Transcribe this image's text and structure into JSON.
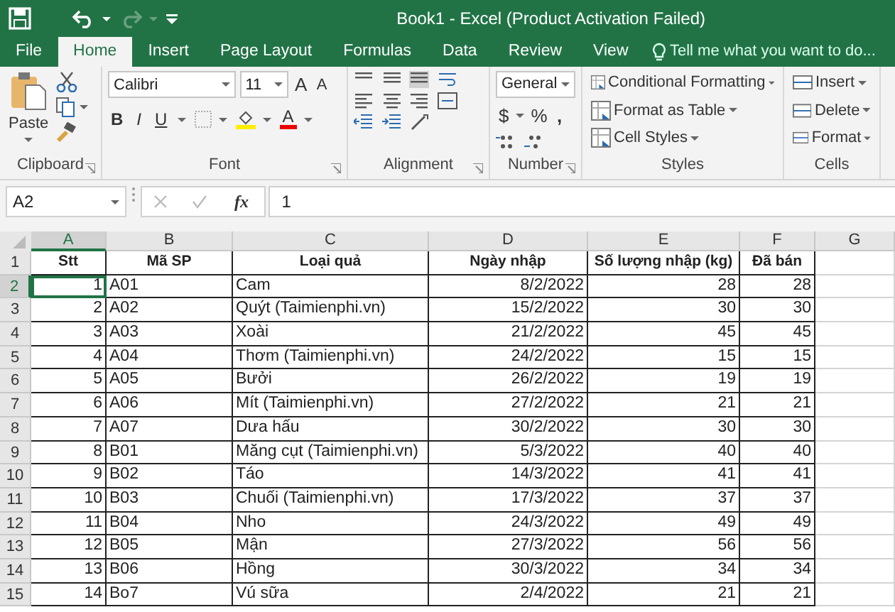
{
  "window": {
    "title": "Book1 - Excel (Product Activation Failed)"
  },
  "tabs": [
    {
      "label": "File",
      "selected": false
    },
    {
      "label": "Home",
      "selected": true
    },
    {
      "label": "Insert",
      "selected": false
    },
    {
      "label": "Page Layout",
      "selected": false
    },
    {
      "label": "Formulas",
      "selected": false
    },
    {
      "label": "Data",
      "selected": false
    },
    {
      "label": "Review",
      "selected": false
    },
    {
      "label": "View",
      "selected": false
    }
  ],
  "tell_me": {
    "placeholder": "Tell me what you want to do..."
  },
  "ribbon": {
    "clipboard": {
      "label": "Clipboard",
      "paste": "Paste"
    },
    "font": {
      "label": "Font",
      "font_name": "Calibri",
      "font_size": "11",
      "grow": "A",
      "shrink": "A",
      "bold": "B",
      "italic": "I",
      "underline": "U",
      "font_color": "A"
    },
    "alignment": {
      "label": "Alignment"
    },
    "number": {
      "label": "Number",
      "format": "General",
      "currency": "$",
      "percent": "%",
      "comma": ","
    },
    "styles": {
      "label": "Styles",
      "buttons": [
        "Conditional Formatting",
        "Format as Table",
        "Cell Styles"
      ]
    },
    "cells": {
      "label": "Cells",
      "buttons": [
        "Insert",
        "Delete",
        "Format"
      ]
    }
  },
  "formula_bar": {
    "name_box": "A2",
    "function_label": "fx",
    "value": "1"
  },
  "sheet": {
    "columns": [
      {
        "label": "A",
        "selected": true,
        "kind": "number"
      },
      {
        "label": "B",
        "selected": false,
        "kind": "text"
      },
      {
        "label": "C",
        "selected": false,
        "kind": "text"
      },
      {
        "label": "D",
        "selected": false,
        "kind": "number"
      },
      {
        "label": "E",
        "selected": false,
        "kind": "number"
      },
      {
        "label": "F",
        "selected": false,
        "kind": "number"
      },
      {
        "label": "G",
        "selected": false,
        "kind": "text"
      }
    ],
    "rows": [
      {
        "header": "1",
        "selected": false,
        "kind": "heading",
        "cells": [
          "Stt",
          "Mã SP",
          "Loại quả",
          "Ngày nhập",
          "Số lượng nhập (kg)",
          "Đã bán",
          ""
        ]
      },
      {
        "header": "2",
        "selected": true,
        "kind": "data",
        "cells": [
          "1",
          "A01",
          "Cam",
          "8/2/2022",
          "28",
          "28",
          ""
        ]
      },
      {
        "header": "3",
        "selected": false,
        "kind": "data",
        "cells": [
          "2",
          "A02",
          "Quýt (Taimienphi.vn)",
          "15/2/2022",
          "30",
          "30",
          ""
        ]
      },
      {
        "header": "4",
        "selected": false,
        "kind": "data",
        "cells": [
          "3",
          "A03",
          "Xoài",
          "21/2/2022",
          "45",
          "45",
          ""
        ]
      },
      {
        "header": "5",
        "selected": false,
        "kind": "data",
        "cells": [
          "4",
          "A04",
          "Thơm  (Taimienphi.vn)",
          "24/2/2022",
          "15",
          "15",
          ""
        ]
      },
      {
        "header": "6",
        "selected": false,
        "kind": "data",
        "cells": [
          "5",
          "A05",
          "Bưởi",
          "26/2/2022",
          "19",
          "19",
          ""
        ]
      },
      {
        "header": "7",
        "selected": false,
        "kind": "data",
        "cells": [
          "6",
          "A06",
          "Mít  (Taimienphi.vn)",
          "27/2/2022",
          "21",
          "21",
          ""
        ]
      },
      {
        "header": "8",
        "selected": false,
        "kind": "data",
        "cells": [
          "7",
          "A07",
          "Dưa hấu",
          "30/2/2022",
          "30",
          "30",
          ""
        ]
      },
      {
        "header": "9",
        "selected": false,
        "kind": "data",
        "cells": [
          "8",
          "B01",
          "Măng cụt  (Taimienphi.vn)",
          "5/3/2022",
          "40",
          "40",
          ""
        ]
      },
      {
        "header": "10",
        "selected": false,
        "kind": "data",
        "cells": [
          "9",
          "B02",
          "Táo",
          "14/3/2022",
          "41",
          "41",
          ""
        ]
      },
      {
        "header": "11",
        "selected": false,
        "kind": "data",
        "cells": [
          "10",
          "B03",
          "Chuối  (Taimienphi.vn)",
          "17/3/2022",
          "37",
          "37",
          ""
        ]
      },
      {
        "header": "12",
        "selected": false,
        "kind": "data",
        "cells": [
          "11",
          "B04",
          "Nho",
          "24/3/2022",
          "49",
          "49",
          ""
        ]
      },
      {
        "header": "13",
        "selected": false,
        "kind": "data",
        "cells": [
          "12",
          "B05",
          "Mận",
          "27/3/2022",
          "56",
          "56",
          ""
        ]
      },
      {
        "header": "14",
        "selected": false,
        "kind": "data",
        "cells": [
          "13",
          "B06",
          "Hồng",
          "30/3/2022",
          "34",
          "34",
          ""
        ]
      },
      {
        "header": "15",
        "selected": false,
        "kind": "data",
        "cells": [
          "14",
          "Bo7",
          "Vú sữa",
          "2/4/2022",
          "21",
          "21",
          ""
        ]
      }
    ]
  }
}
